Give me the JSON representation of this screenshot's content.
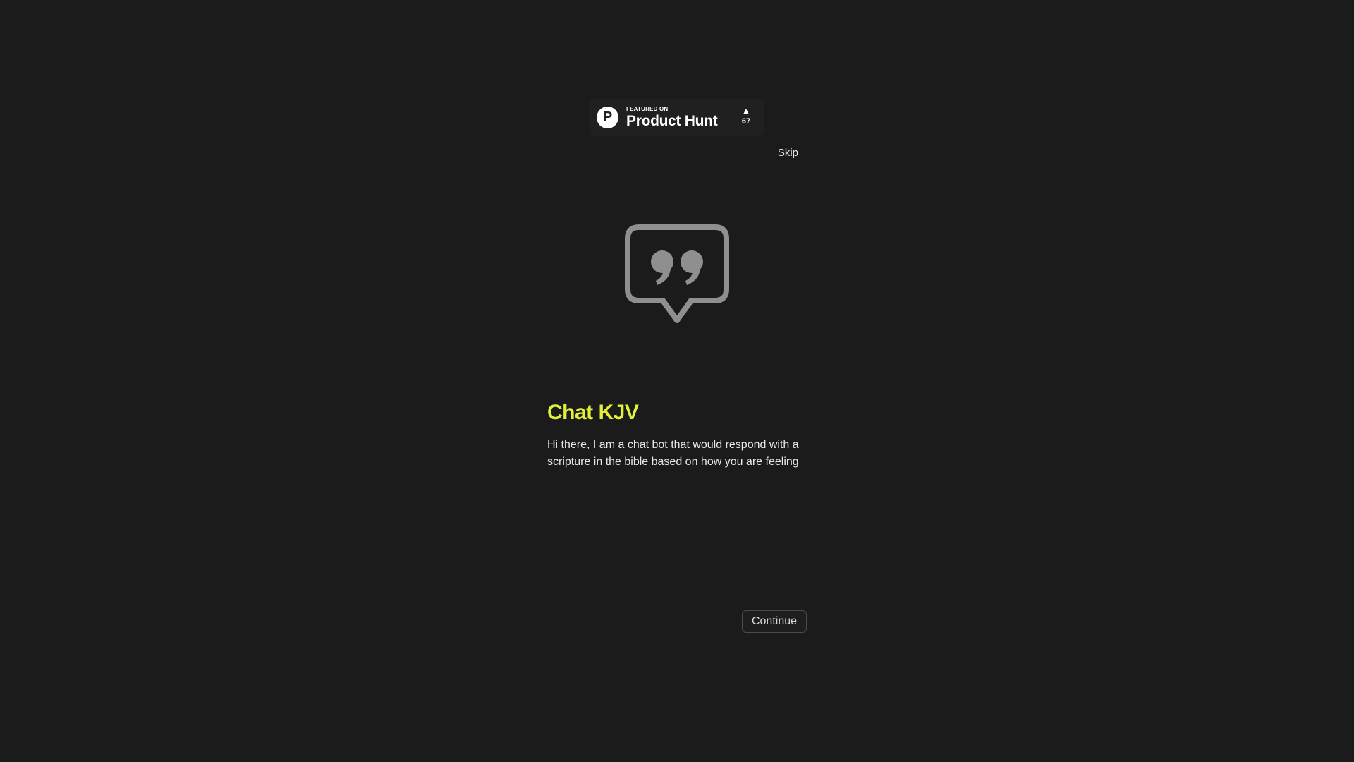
{
  "badge": {
    "logo_letter": "P",
    "featured_label": "FEATURED ON",
    "brand": "Product Hunt",
    "vote_arrow": "▲",
    "vote_count": "67",
    "logo_icon": "product-hunt-logo-icon"
  },
  "nav": {
    "skip_label": "Skip"
  },
  "hero": {
    "icon": "quote-bubble-icon",
    "title": "Chat KJV",
    "description": "Hi there, I am a chat bot that would respond with a scripture in the bible based on how you are feeling"
  },
  "actions": {
    "continue_label": "Continue"
  },
  "colors": {
    "background": "#1b1b1b",
    "accent": "#e3f03a",
    "icon_gray": "#8f8f8f"
  }
}
